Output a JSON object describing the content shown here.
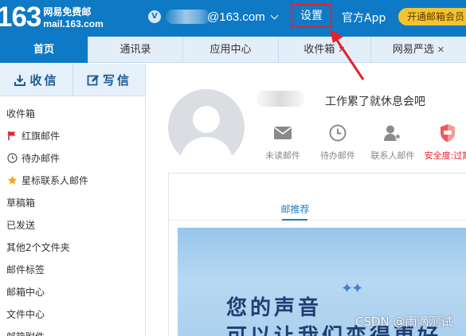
{
  "header": {
    "logo_number": "163",
    "logo_cn": "网易免费邮",
    "logo_domain": "mail.163.com",
    "user_avatar_letter": "V",
    "user_email": "@163.com",
    "settings_label": "设置",
    "app_label": "官方App",
    "vip_label": "开通邮箱会员"
  },
  "tabs": [
    {
      "label": "首页",
      "active": true
    },
    {
      "label": "通讯录"
    },
    {
      "label": "应用中心"
    },
    {
      "label": "收件箱",
      "closable": true
    },
    {
      "label": "网易严选",
      "closable": true
    }
  ],
  "sidebar": {
    "receive_label": "收信",
    "write_label": "写信",
    "folders": [
      {
        "label": "收件箱"
      },
      {
        "label": "红旗邮件",
        "icon": "red-flag-icon"
      },
      {
        "label": "待办邮件",
        "icon": "clock-icon"
      },
      {
        "label": "星标联系人邮件",
        "icon": "star-icon"
      },
      {
        "label": "草稿箱"
      },
      {
        "label": "已发送"
      },
      {
        "label": "其他2个文件夹"
      },
      {
        "label": "邮件标签"
      },
      {
        "label": "邮箱中心"
      },
      {
        "label": "文件中心"
      },
      {
        "label": "邮箱附件"
      }
    ]
  },
  "main": {
    "motto": "工作累了就休息会吧",
    "stats": [
      {
        "label": "未读邮件",
        "icon": "envelope-icon"
      },
      {
        "label": "待办邮件",
        "icon": "clock-icon"
      },
      {
        "label": "联系人邮件",
        "icon": "contact-star-icon"
      },
      {
        "label": "安全度:过期",
        "icon": "shield-icon"
      }
    ],
    "recommend_title": "邮推荐",
    "banner_line1": "您的声音",
    "banner_line2": "可以让我们变得更好"
  },
  "watermark": "CSDN @雨滴测试",
  "colors": {
    "header_blue": "#0e79c4",
    "highlight_red": "#e8202a",
    "vip_yellow": "#f5c330",
    "banner_text": "#1f3f73"
  }
}
